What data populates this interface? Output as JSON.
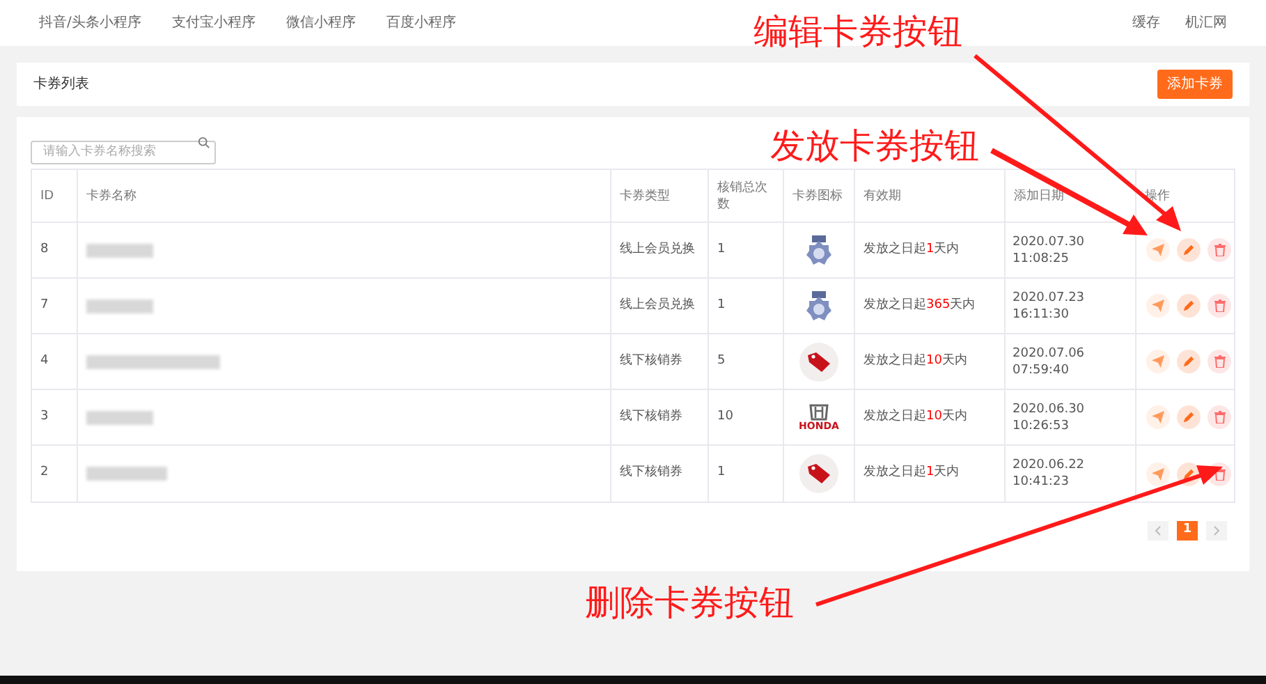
{
  "top_nav": {
    "tabs": [
      {
        "label": "抖音/头条小程序"
      },
      {
        "label": "支付宝小程序"
      },
      {
        "label": "微信小程序"
      },
      {
        "label": "百度小程序"
      }
    ],
    "right": [
      "缓存",
      "机汇网"
    ]
  },
  "header_card": {
    "title": "卡券列表",
    "add_button": "添加卡券"
  },
  "search": {
    "placeholder": "请输入卡券名称搜索"
  },
  "table": {
    "columns": [
      "ID",
      "卡券名称",
      "卡券类型",
      "核销总次数",
      "卡券图标",
      "有效期",
      "添加日期",
      "操作"
    ],
    "rows": [
      {
        "id": "8",
        "type": "线上会员兑换",
        "count": "1",
        "kind": "medal",
        "validity": {
          "prefix": "发放之日起",
          "number": "1",
          "suffix": "天内"
        },
        "date": "2020.07.30 11:08:25"
      },
      {
        "id": "7",
        "type": "线上会员兑换",
        "count": "1",
        "kind": "medal",
        "validity": {
          "prefix": "发放之日起",
          "number": "365",
          "suffix": "天内"
        },
        "date": "2020.07.23 16:11:30"
      },
      {
        "id": "4",
        "type": "线下核销券",
        "count": "5",
        "kind": "tag",
        "validity": {
          "prefix": "发放之日起",
          "number": "10",
          "suffix": "天内"
        },
        "date": "2020.07.06 07:59:40"
      },
      {
        "id": "3",
        "type": "线下核销券",
        "count": "10",
        "kind": "car_logo",
        "logo_text": "HONDA",
        "validity": {
          "prefix": "发放之日起",
          "number": "10",
          "suffix": "天内"
        },
        "date": "2020.06.30 10:26:53"
      },
      {
        "id": "2",
        "type": "线下核销券",
        "count": "1",
        "kind": "tag",
        "validity": {
          "prefix": "发放之日起",
          "number": "1",
          "suffix": "天内"
        },
        "date": "2020.06.22 10:41:23"
      }
    ]
  },
  "pagination": {
    "pages": [
      {
        "label": "1",
        "selected": true
      }
    ]
  },
  "annotations": [
    "编辑卡券按钮",
    "发放卡券按钮",
    "删除卡券按钮"
  ]
}
